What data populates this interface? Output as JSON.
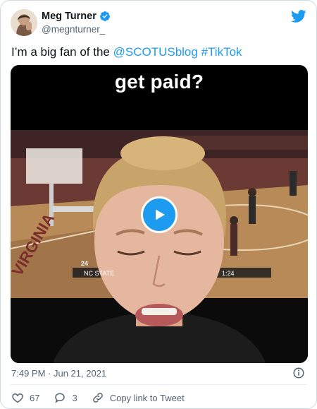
{
  "author": {
    "name": "Meg Turner",
    "handle": "@megnturner_",
    "verified": true
  },
  "tweet": {
    "text_plain": "I’m a big fan of the ",
    "mention": "@SCOTUSblog",
    "space": " ",
    "hashtag": "#TikTok"
  },
  "media": {
    "caption": "get paid?",
    "scoreboard": {
      "team": "NC STATE",
      "score": "24",
      "clock": "1:24"
    },
    "play_icon": "play-icon"
  },
  "meta": {
    "time": "7:49 PM",
    "separator": " · ",
    "date": "Jun 21, 2021"
  },
  "actions": {
    "likes": "67",
    "replies": "3",
    "copy_link": "Copy link to Tweet"
  },
  "colors": {
    "accent": "#1d9bf0",
    "like_icon": "#536471"
  }
}
